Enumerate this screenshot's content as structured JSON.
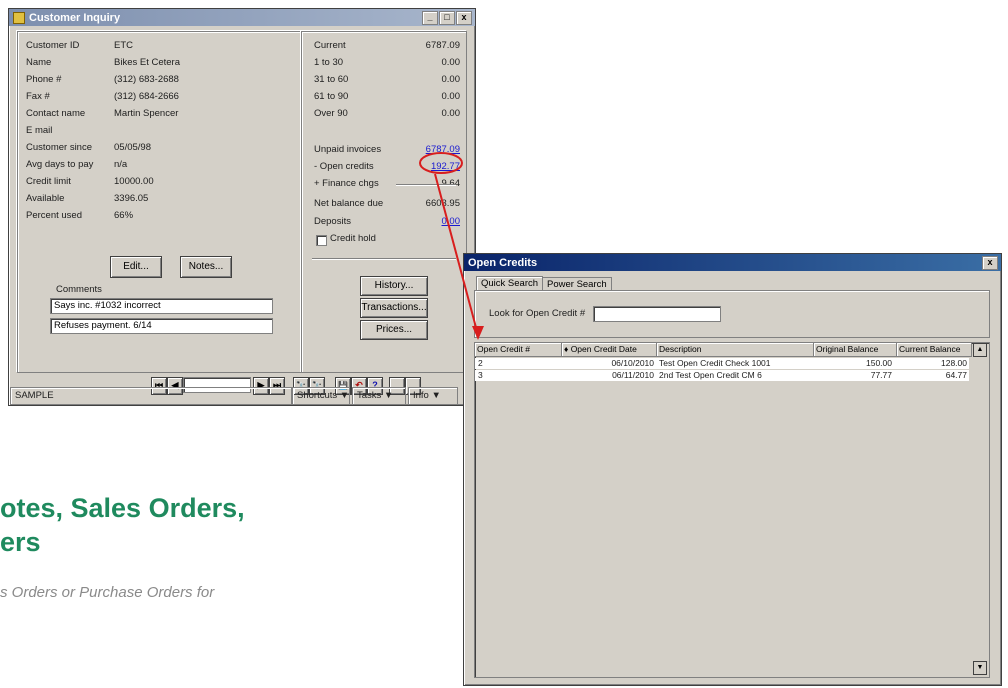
{
  "background_text": {
    "headline_line1": "otes, Sales Orders,",
    "headline_line2": "ers",
    "subline": "s Orders or Purchase Orders for",
    "headline_color": "#1f8a5e"
  },
  "customer_window": {
    "title": "Customer Inquiry",
    "title_buttons": [
      "_",
      "□",
      "x"
    ],
    "fields": [
      {
        "label": "Customer ID",
        "value": "ETC"
      },
      {
        "label": "Name",
        "value": "Bikes Et Cetera"
      },
      {
        "label": "Phone #",
        "value": "(312) 683-2688"
      },
      {
        "label": "Fax #",
        "value": "(312) 684-2666"
      },
      {
        "label": "Contact name",
        "value": "Martin Spencer"
      },
      {
        "label": "E mail",
        "value": ""
      },
      {
        "label": "Customer since",
        "value": "05/05/98"
      },
      {
        "label": "Avg days to pay",
        "value": "n/a"
      },
      {
        "label": "Credit limit",
        "value": "10000.00"
      },
      {
        "label": "Available",
        "value": "3396.05"
      },
      {
        "label": "Percent used",
        "value": "66%"
      }
    ],
    "aging": [
      {
        "label": "Current",
        "value": "6787.09"
      },
      {
        "label": "1 to 30",
        "value": "0.00"
      },
      {
        "label": "31 to 60",
        "value": "0.00"
      },
      {
        "label": "61 to 90",
        "value": "0.00"
      },
      {
        "label": "Over 90",
        "value": "0.00"
      }
    ],
    "summary": [
      {
        "label": "Unpaid invoices",
        "value": "6787.09",
        "link": true
      },
      {
        "label": "- Open credits",
        "value": "192.77",
        "link": true
      },
      {
        "label": "+ Finance chgs",
        "value": "9.64",
        "link": false
      }
    ],
    "net_balance": {
      "label": "Net balance due",
      "value": "6603.95"
    },
    "deposits": {
      "label": "Deposits",
      "value": "0.00"
    },
    "credit_hold_label": "Credit hold",
    "edit_button": "Edit...",
    "notes_button": "Notes...",
    "comments_label": "Comments",
    "comments": [
      "Says inc. #1032 incorrect",
      "Refuses payment. 6/14"
    ],
    "history_button": "History...",
    "transactions_button": "Transactions...",
    "prices_button": "Prices...",
    "nav_buttons": [
      "⏮",
      "◀",
      "▶",
      "⏭"
    ],
    "search_buttons": [
      "🔭",
      "🔭"
    ],
    "tool_buttons": [
      "💾",
      "↶",
      "?"
    ],
    "status_left": "SAMPLE",
    "status_menus": [
      "Shortcuts ▼",
      "Tasks ▼",
      "Info ▼"
    ]
  },
  "open_credits_window": {
    "title": "Open Credits",
    "close_button": "x",
    "tabs": [
      "Quick Search",
      "Power Search"
    ],
    "search_label": "Look for Open Credit #",
    "search_value": "",
    "columns": [
      "Open Credit #",
      "♦ Open Credit Date",
      "Description",
      "Original Balance",
      "Current Balance"
    ],
    "rows": [
      {
        "number": "2",
        "date": "06/10/2010",
        "description": "Test Open Credit Check 1001",
        "original": "150.00",
        "current": "128.00"
      },
      {
        "number": "3",
        "date": "06/11/2010",
        "description": "2nd Test Open Credit CM 6",
        "original": "77.77",
        "current": "64.77"
      }
    ]
  },
  "annotation": {
    "color": "#d81e1e"
  }
}
